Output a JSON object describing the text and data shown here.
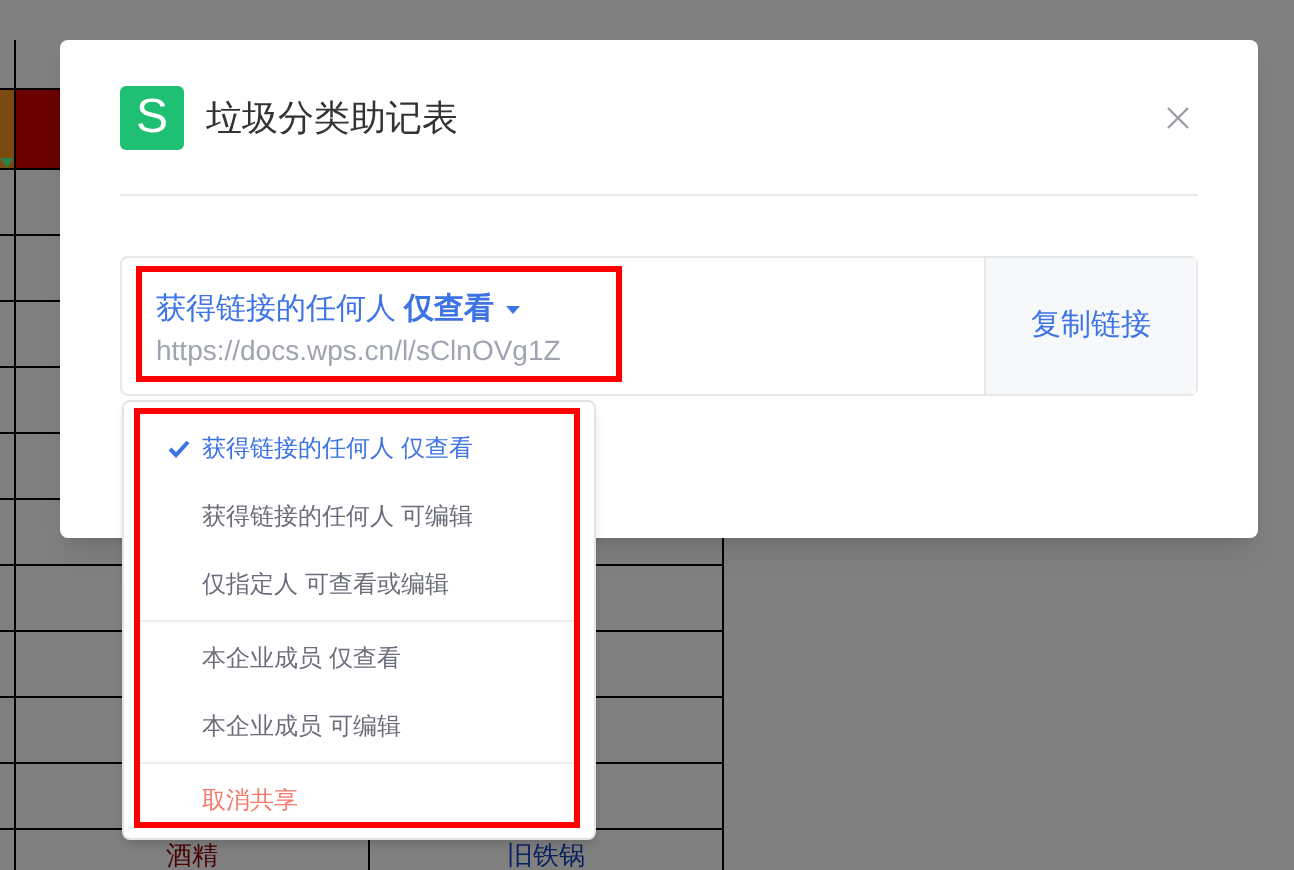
{
  "sheet": {
    "bottom_row": [
      "酒精",
      "旧铁锅"
    ]
  },
  "dialog": {
    "logo": "S",
    "title": "垃圾分类助记表",
    "share_link": {
      "highlighted": true,
      "permission": "获得链接的任何人 **仅查看**",
      "url": "https://docs.wps.cn/l/sClnOVg1Z",
      "copy_button": "复制链接"
    },
    "permission_menu": {
      "highlighted": true,
      "groups": [
        [
          {
            "label": "获得链接的任何人 仅查看",
            "kind": "option",
            "selected": true
          },
          {
            "label": "获得链接的任何人 可编辑",
            "kind": "option",
            "selected": false
          },
          {
            "label": "仅指定人 可查看或编辑",
            "kind": "option",
            "selected": false
          }
        ],
        [
          {
            "label": "本企业成员 仅查看",
            "kind": "option",
            "selected": false
          },
          {
            "label": "本企业成员 可编辑",
            "kind": "option",
            "selected": false
          }
        ],
        [
          {
            "label": "取消共享",
            "kind": "danger",
            "selected": false
          }
        ]
      ]
    }
  }
}
